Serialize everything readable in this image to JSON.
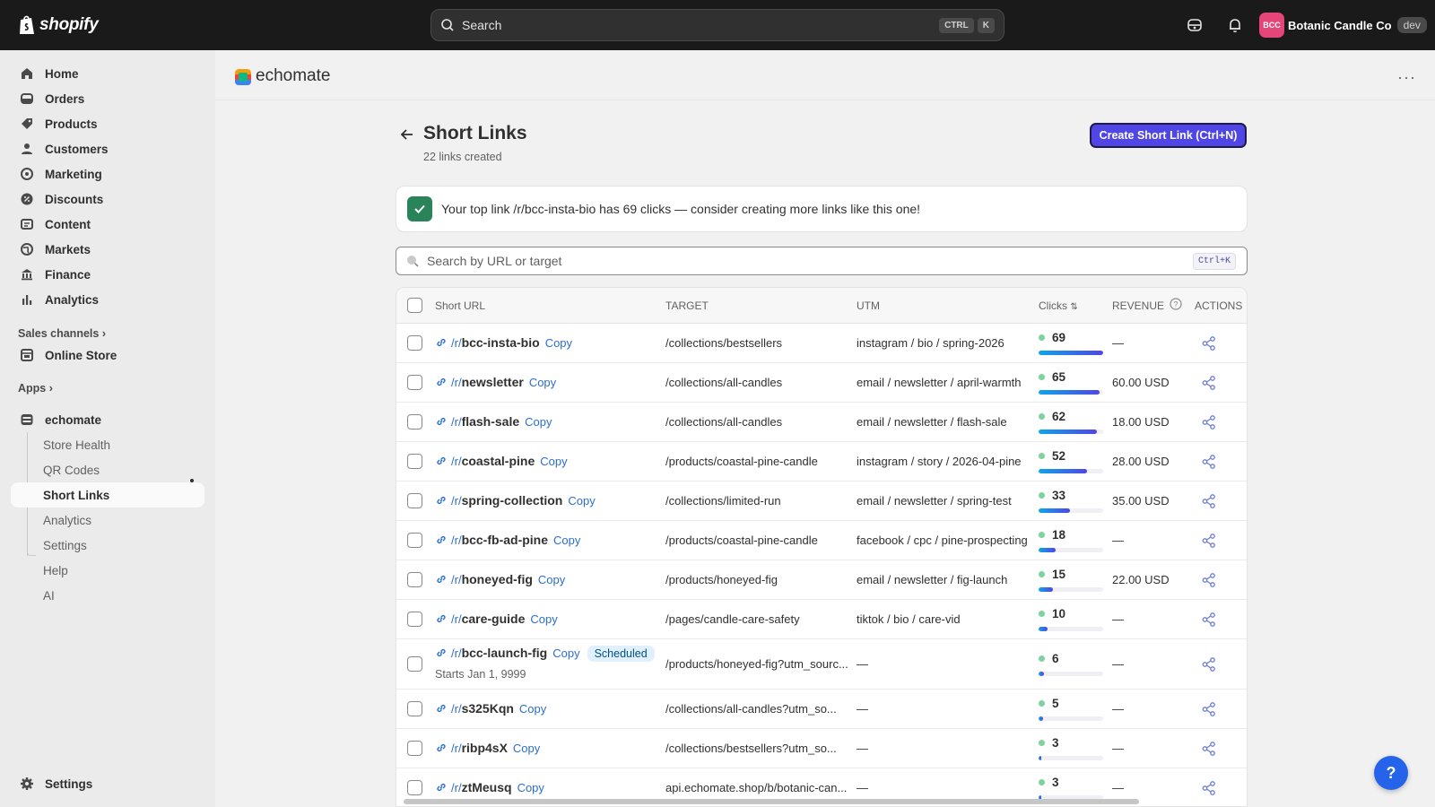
{
  "topbar": {
    "brand": "shopify",
    "search_label": "Search",
    "shortcut_keys": [
      "CTRL",
      "K"
    ],
    "avatar_initials": "BCC",
    "store_name": "Botanic Candle Co",
    "env_badge": "dev",
    "icons": [
      "shopify-bag-icon",
      "search-icon",
      "mailbox-icon",
      "bell-icon"
    ]
  },
  "sidebar": {
    "items": [
      {
        "label": "Home",
        "icon": "home-icon"
      },
      {
        "label": "Orders",
        "icon": "inbox-icon"
      },
      {
        "label": "Products",
        "icon": "tag-icon"
      },
      {
        "label": "Customers",
        "icon": "person-icon"
      },
      {
        "label": "Marketing",
        "icon": "target-icon"
      },
      {
        "label": "Discounts",
        "icon": "discount-icon"
      },
      {
        "label": "Content",
        "icon": "content-icon"
      },
      {
        "label": "Markets",
        "icon": "globe-icon"
      },
      {
        "label": "Finance",
        "icon": "bank-icon"
      },
      {
        "label": "Analytics",
        "icon": "bar-chart-icon"
      }
    ],
    "sales_channels_label": "Sales channels",
    "online_store_label": "Online Store",
    "apps_label": "Apps",
    "app_name": "echomate",
    "app_sub_items": [
      "Store Health",
      "QR Codes",
      "Short Links",
      "Analytics",
      "Settings",
      "Help",
      "AI"
    ],
    "active_sub_item": "Short Links",
    "settings_label": "Settings"
  },
  "app_header": {
    "title": "echomate",
    "more_label": "···"
  },
  "page": {
    "title": "Short Links",
    "subtitle": "22 links created",
    "create_button": "Create Short Link (Ctrl+N)",
    "banner": "Your top link /r/bcc-insta-bio has 69 clicks — consider creating more links like this one!",
    "search_placeholder": "Search by URL or target",
    "search_shortcut": "Ctrl+K"
  },
  "table": {
    "headers": {
      "short_url": "Short URL",
      "target": "TARGET",
      "utm": "UTM",
      "clicks": "Clicks",
      "revenue": "REVENUE",
      "actions": "ACTIONS"
    },
    "max_clicks": 69,
    "rows": [
      {
        "prefix": "/r/",
        "slug": "bcc-insta-bio",
        "copy": "Copy",
        "target": "/collections/bestsellers",
        "utm": "instagram / bio / spring-2026",
        "clicks": "69",
        "revenue": "—"
      },
      {
        "prefix": "/r/",
        "slug": "newsletter",
        "copy": "Copy",
        "target": "/collections/all-candles",
        "utm": "email / newsletter / april-warmth",
        "clicks": "65",
        "revenue": "60.00 USD"
      },
      {
        "prefix": "/r/",
        "slug": "flash-sale",
        "copy": "Copy",
        "target": "/collections/all-candles",
        "utm": "email / newsletter / flash-sale",
        "clicks": "62",
        "revenue": "18.00 USD"
      },
      {
        "prefix": "/r/",
        "slug": "coastal-pine",
        "copy": "Copy",
        "target": "/products/coastal-pine-candle",
        "utm": "instagram / story / 2026-04-pine",
        "clicks": "52",
        "revenue": "28.00 USD"
      },
      {
        "prefix": "/r/",
        "slug": "spring-collection",
        "copy": "Copy",
        "target": "/collections/limited-run",
        "utm": "email / newsletter / spring-test",
        "clicks": "33",
        "revenue": "35.00 USD"
      },
      {
        "prefix": "/r/",
        "slug": "bcc-fb-ad-pine",
        "copy": "Copy",
        "target": "/products/coastal-pine-candle",
        "utm": "facebook / cpc / pine-prospecting",
        "clicks": "18",
        "revenue": "—"
      },
      {
        "prefix": "/r/",
        "slug": "honeyed-fig",
        "copy": "Copy",
        "target": "/products/honeyed-fig",
        "utm": "email / newsletter / fig-launch",
        "clicks": "15",
        "revenue": "22.00 USD"
      },
      {
        "prefix": "/r/",
        "slug": "care-guide",
        "copy": "Copy",
        "target": "/pages/candle-care-safety",
        "utm": "tiktok / bio / care-vid",
        "clicks": "10",
        "revenue": "—"
      },
      {
        "prefix": "/r/",
        "slug": "bcc-launch-fig",
        "copy": "Copy",
        "badge": "Scheduled",
        "starts": "Starts Jan 1, 9999",
        "target": "/products/honeyed-fig?utm_sourc...",
        "utm": "—",
        "clicks": "6",
        "revenue": "—"
      },
      {
        "prefix": "/r/",
        "slug": "s325Kqn",
        "copy": "Copy",
        "target": "/collections/all-candles?utm_so...",
        "utm": "—",
        "clicks": "5",
        "revenue": "—"
      },
      {
        "prefix": "/r/",
        "slug": "ribp4sX",
        "copy": "Copy",
        "target": "/collections/bestsellers?utm_so...",
        "utm": "—",
        "clicks": "3",
        "revenue": "—"
      },
      {
        "prefix": "/r/",
        "slug": "ztMeusq",
        "copy": "Copy",
        "target": "api.echomate.shop/b/botanic-can...",
        "utm": "—",
        "clicks": "3",
        "revenue": "—"
      }
    ]
  },
  "help_button": "?",
  "colors": {
    "accent": "#4f46e5",
    "link": "#2c6ecb",
    "success": "#29845a",
    "topbar": "#1a1a1a"
  }
}
